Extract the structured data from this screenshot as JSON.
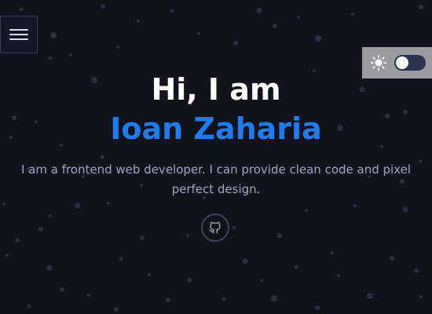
{
  "hero": {
    "greeting": "Hi, I am",
    "name": "Ioan Zaharia",
    "tagline": "I am a frontend web developer. I can provide clean code and pixel perfect design."
  },
  "icons": {
    "menu": "hamburger-menu-icon",
    "theme": "sun-icon",
    "social": "github-icon"
  },
  "theme_toggle": {
    "state": "dark"
  },
  "colors": {
    "background": "#10131c",
    "accent": "#1e7cf0",
    "heading": "#ffffff",
    "text": "#9ea5ba",
    "toggle_panel": "#9a9ba0",
    "toggle_track": "#2c3450"
  }
}
